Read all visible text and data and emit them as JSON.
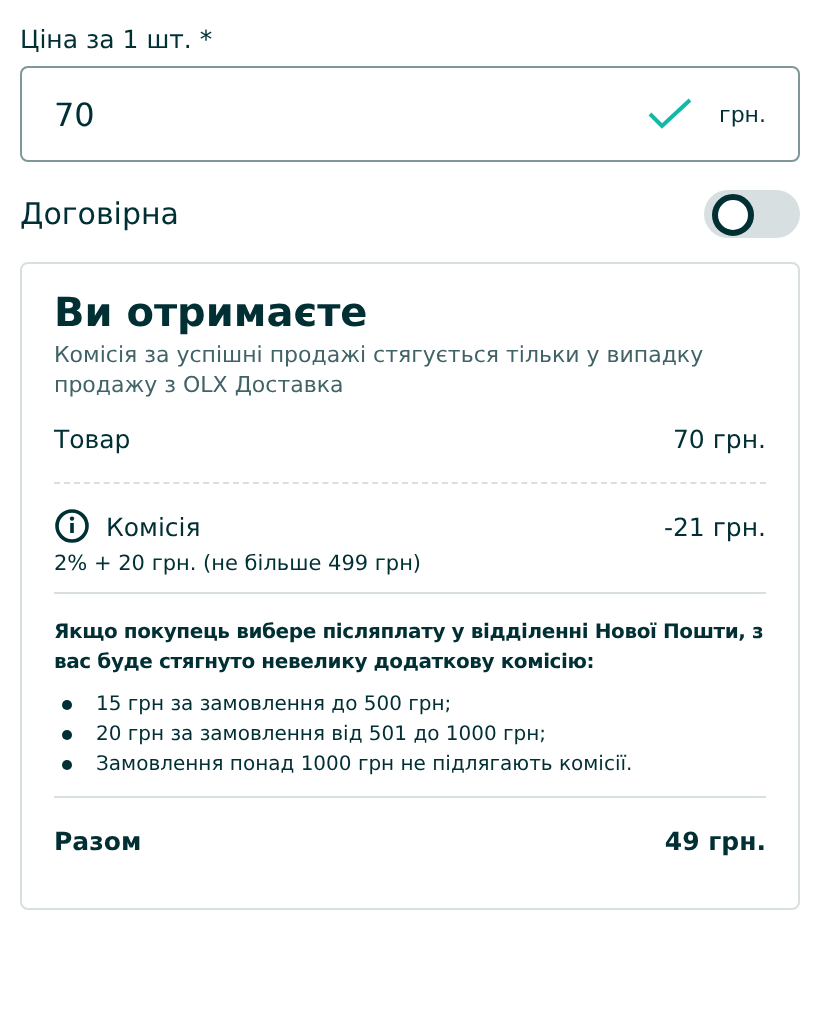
{
  "price_field": {
    "label": "Ціна за 1 шт. *",
    "value": "70",
    "valid": true,
    "unit": "грн."
  },
  "negotiable": {
    "label": "Договірна",
    "on": false
  },
  "summary": {
    "title": "Ви отримаєте",
    "subtitle": "Комісія за успішні продажі стягується тільки у випадку продажу з OLX Доставка",
    "item": {
      "label": "Товар",
      "amount": "70 грн."
    },
    "commission": {
      "label": "Комісія",
      "amount": "-21 грн.",
      "note": "2% + 20 грн. (не більше 499 грн)"
    },
    "cod_notice": "Якщо покупець вибере післяплату у відділенні Нової Пошти, з вас буде стягнуто невелику додаткову комісію:",
    "cod_fees": [
      "15 грн за замовлення до 500 грн;",
      "20 грн за замовлення від 501 до 1000 грн;",
      "Замовлення понад 1000 грн не підлягають комісії."
    ],
    "total": {
      "label": "Разом",
      "amount": "49 грн."
    }
  }
}
